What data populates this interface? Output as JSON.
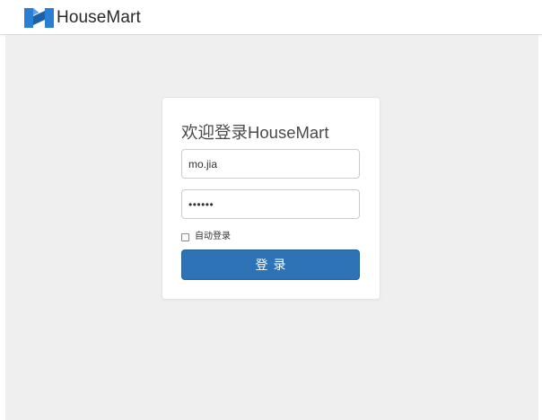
{
  "header": {
    "logo_icon": "housemart-h-logo-icon",
    "brand": "HouseMart",
    "colors": {
      "logo_blue": "#2a7fd4",
      "logo_dark": "#1f5fa8"
    }
  },
  "login": {
    "title": "欢迎登录HouseMart",
    "username_value": "mo.jia",
    "password_value": "••••••",
    "remember_label": "自动登录",
    "remember_checked": false,
    "submit_label": "登录",
    "colors": {
      "button": "#2e73b5",
      "page_bg": "#efefef"
    }
  }
}
